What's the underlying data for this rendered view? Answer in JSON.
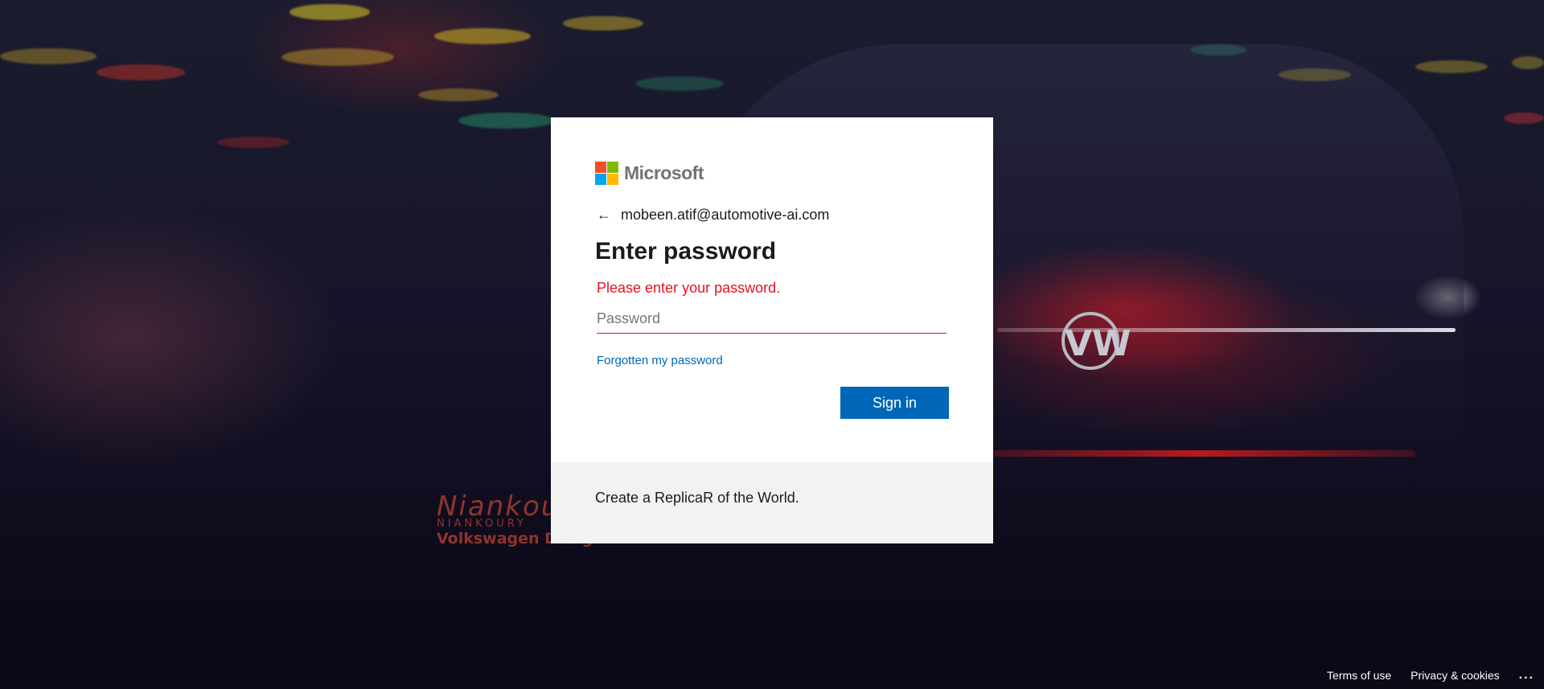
{
  "background": {
    "brand_watermark_signature": "Niankou",
    "brand_watermark_line1": "NIANKOURY",
    "brand_watermark_line2": "Volkswagen Design",
    "emblem": "VW"
  },
  "card": {
    "brand_name": "Microsoft",
    "identity_email": "mobeen.atif@automotive-ai.com",
    "title": "Enter password",
    "error_message": "Please enter your password.",
    "password_placeholder": "Password",
    "password_value": "",
    "forgot_link": "Forgotten my password",
    "signin_label": "Sign in",
    "footer_tagline": "Create a ReplicaR of the World.",
    "icons": {
      "back": "arrow-left-icon",
      "logo": "microsoft-logo-icon"
    }
  },
  "colors": {
    "logo_red": "#f25022",
    "logo_green": "#7fba00",
    "logo_blue": "#00a4ef",
    "logo_yellow": "#ffb900",
    "accent": "#0067b8",
    "error": "#e81123"
  },
  "footer": {
    "terms": "Terms of use",
    "privacy": "Privacy & cookies",
    "more": "..."
  }
}
